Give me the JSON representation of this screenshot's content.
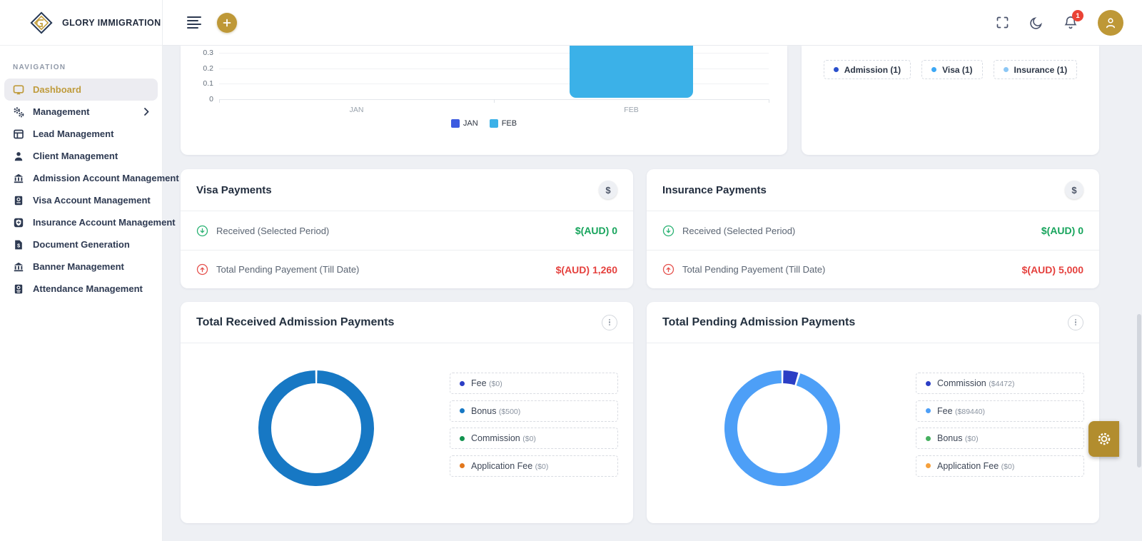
{
  "brand": {
    "name": "GLORY IMMIGRATION"
  },
  "sidebar": {
    "section_label": "NAVIGATION",
    "items": [
      {
        "label": "Dashboard",
        "icon": "dashboard-screen-icon",
        "active": true
      },
      {
        "label": "Management",
        "icon": "gears-icon",
        "has_submenu": true
      },
      {
        "label": "Lead Management",
        "icon": "layout-table-icon"
      },
      {
        "label": "Client Management",
        "icon": "user-icon"
      },
      {
        "label": "Admission Account Management",
        "icon": "bank-icon"
      },
      {
        "label": "Visa Account Management",
        "icon": "passport-icon"
      },
      {
        "label": "Insurance Account Management",
        "icon": "shield-icon"
      },
      {
        "label": "Document Generation",
        "icon": "document-dollar-icon"
      },
      {
        "label": "Banner Management",
        "icon": "bank-icon"
      },
      {
        "label": "Attendance Management",
        "icon": "id-book-icon"
      }
    ]
  },
  "header": {
    "notification_count": "1",
    "icons": [
      "menu-icon",
      "add-button",
      "fullscreen-icon",
      "dark-mode-icon",
      "notifications-icon",
      "avatar"
    ]
  },
  "chart_data": [
    {
      "id": "monthly_bar",
      "type": "bar",
      "categories": [
        "JAN",
        "FEB"
      ],
      "series": [
        {
          "name": "JAN",
          "color": "#3D5BE0",
          "values": [
            0,
            0
          ]
        },
        {
          "name": "FEB",
          "color": "#3BB1E8",
          "values": [
            0,
            1
          ]
        }
      ],
      "visible_y_ticks": [
        "0",
        "0.1",
        "0.2",
        "0.3"
      ],
      "ylim_visible": [
        0,
        0.35
      ],
      "clipped_top": true,
      "grid": true,
      "legend_position": "bottom"
    },
    {
      "id": "accounts_legend",
      "type": "pie",
      "note_visible": "legend chips only; chart body scrolled out of view",
      "slices": [
        {
          "label": "Admission",
          "count": 1,
          "color": "#2B50CC"
        },
        {
          "label": "Visa",
          "count": 1,
          "color": "#3DA8F5"
        },
        {
          "label": "Insurance",
          "count": 1,
          "color": "#8CC7F5"
        }
      ]
    },
    {
      "id": "received_admission",
      "type": "donut",
      "title": "Total Received Admission Payments",
      "slices": [
        {
          "label": "Fee",
          "amount": "$0",
          "value": 0,
          "color": "#2B3EC5"
        },
        {
          "label": "Bonus",
          "amount": "$500",
          "value": 500,
          "color": "#1778C4"
        },
        {
          "label": "Commission",
          "amount": "$0",
          "value": 0,
          "color": "#12934F"
        },
        {
          "label": "Application Fee",
          "amount": "$0",
          "value": 0,
          "color": "#E2771C"
        }
      ]
    },
    {
      "id": "pending_admission",
      "type": "donut",
      "title": "Total Pending Admission Payments",
      "slices": [
        {
          "label": "Commission",
          "amount": "$4472",
          "value": 4472,
          "color": "#2B3EC5"
        },
        {
          "label": "Fee",
          "amount": "$89440",
          "value": 89440,
          "color": "#4D9FF7"
        },
        {
          "label": "Bonus",
          "amount": "$0",
          "value": 0,
          "color": "#46B05F"
        },
        {
          "label": "Application Fee",
          "amount": "$0",
          "value": 0,
          "color": "#F5A03C"
        }
      ]
    }
  ],
  "payment_cards": [
    {
      "title": "Visa Payments",
      "badge": "$",
      "rows": [
        {
          "icon": "arrow-down-circle-icon",
          "label": "Received (Selected Period)",
          "value": "$(AUD) 0",
          "status": "positive"
        },
        {
          "icon": "arrow-up-circle-icon",
          "label": "Total Pending Payement (Till Date)",
          "value": "$(AUD) 1,260",
          "status": "negative"
        }
      ]
    },
    {
      "title": "Insurance Payments",
      "badge": "$",
      "rows": [
        {
          "icon": "arrow-down-circle-icon",
          "label": "Received (Selected Period)",
          "value": "$(AUD) 0",
          "status": "positive"
        },
        {
          "icon": "arrow-up-circle-icon",
          "label": "Total Pending Payement (Till Date)",
          "value": "$(AUD) 5,000",
          "status": "negative"
        }
      ]
    }
  ],
  "colors": {
    "gold": "#BE9837",
    "navy": "#2E3A52",
    "green": "#17A45C",
    "red": "#E5413E",
    "badge_red": "#EA4335",
    "page_bg": "#EEF0F4"
  }
}
